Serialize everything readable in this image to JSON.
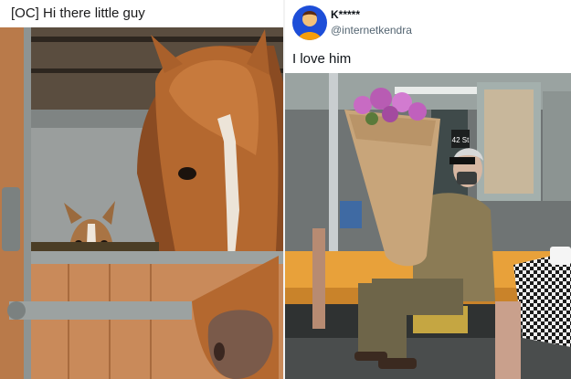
{
  "left_post": {
    "title": "[OC] Hi there little guy",
    "image": {
      "subject": "horse-in-stable-with-small-horse-behind-door"
    }
  },
  "tweet": {
    "author": {
      "display_name": "K*****",
      "handle": "@internetkendra",
      "avatar": {
        "accent": "#1d4ed8"
      }
    },
    "text": "I love him",
    "media": {
      "subject": "man-with-flower-bouquet-on-subway",
      "badge": "42 St"
    }
  },
  "colors": {
    "text_primary": "#0f1419",
    "text_secondary": "#536471",
    "stall_wood": "#c98a5a",
    "subway_seat": "#e8a13a"
  }
}
